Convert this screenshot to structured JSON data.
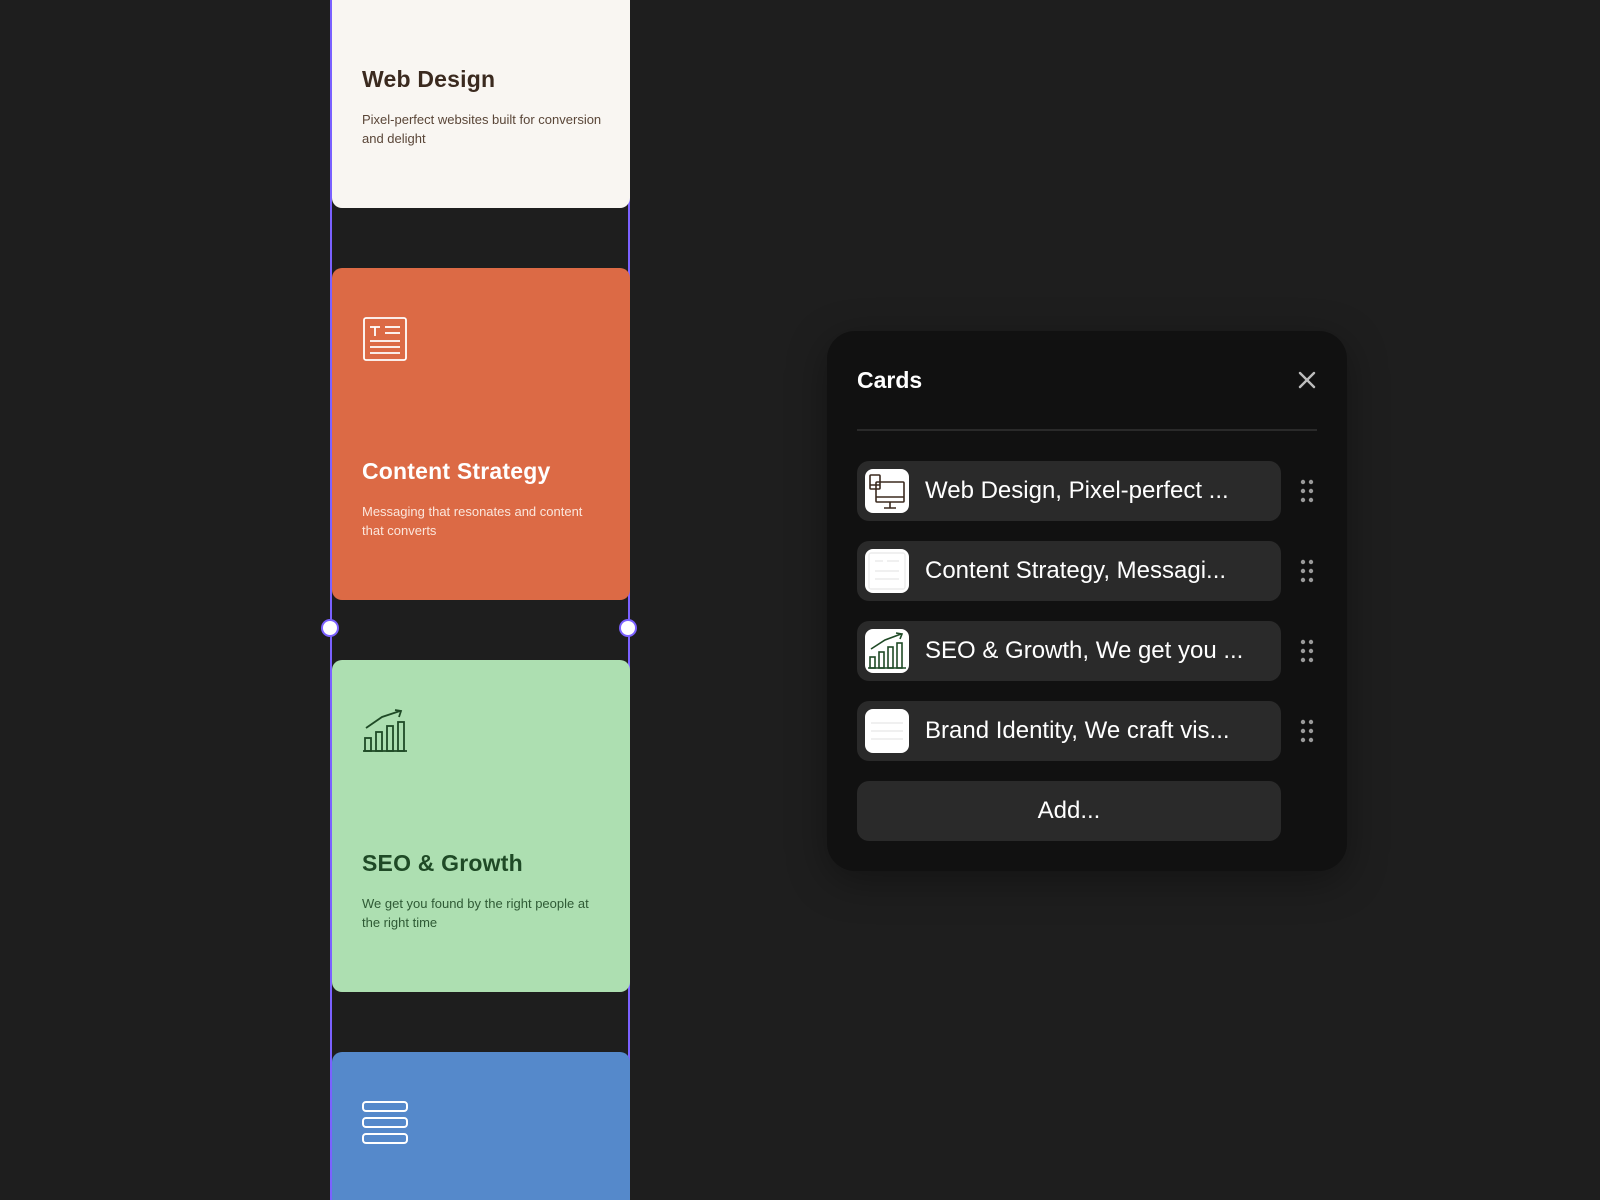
{
  "colors": {
    "canvas_background": "#1e1e1e",
    "selection_accent": "#7b61ff",
    "panel_background": "#111111",
    "row_background": "#2a2a2a"
  },
  "cards": [
    {
      "title": "Web Design",
      "description": "Pixel-perfect websites built for conversion and delight",
      "background": "#f9f6f2",
      "icon": "desktop-monitor-icon"
    },
    {
      "title": "Content Strategy",
      "description": "Messaging that resonates and content that converts",
      "background": "#dc6a45",
      "icon": "text-document-icon"
    },
    {
      "title": "SEO & Growth",
      "description": "We get you found by the right people at the right time",
      "background": "#addfb1",
      "icon": "growth-chart-icon"
    },
    {
      "background": "#5589cb",
      "icon": "stacked-layers-icon"
    }
  ],
  "panel": {
    "title": "Cards",
    "close_icon": "close-icon",
    "items": [
      {
        "label": "Web Design, Pixel-perfect ...",
        "thumbnail_icon": "desktop-monitor-icon"
      },
      {
        "label": "Content Strategy, Messagi...",
        "thumbnail_icon": "text-document-icon"
      },
      {
        "label": "SEO & Growth, We get you ...",
        "thumbnail_icon": "growth-chart-icon"
      },
      {
        "label": "Brand Identity, We craft vis...",
        "thumbnail_icon": "stacked-layers-icon"
      }
    ],
    "add_label": "Add..."
  }
}
